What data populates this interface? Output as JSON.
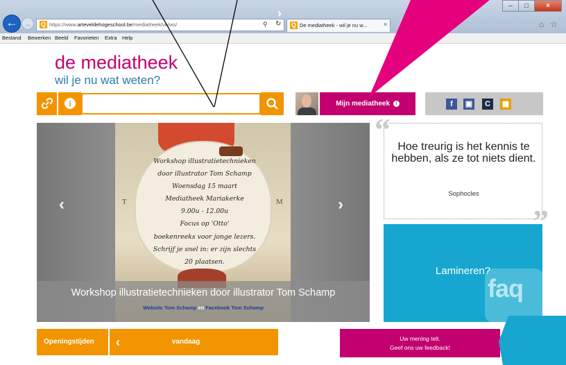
{
  "browser": {
    "address_prefix": "https://www.",
    "address_domain": "arteveldehogeschool.be",
    "address_path": "/mediatheek/ve/ws/",
    "tab_title": "De mediatheek - wil je nu w...",
    "favicon_text": "Q",
    "menu": [
      "Bestand",
      "Bewerken",
      "Beeld",
      "Favorieten",
      "Extra",
      "Help"
    ],
    "icons": [
      "back-arrow-icon",
      "forward-arrow-icon",
      "search-icon",
      "refresh-icon",
      "close-icon",
      "home-icon",
      "star-icon"
    ]
  },
  "header": {
    "title": "de mediatheek",
    "subtitle": "wil je nu wat weten?"
  },
  "search": {
    "value": "",
    "link_icon": "link-icon",
    "info_icon": "info-icon",
    "search_icon": "search-icon"
  },
  "account": {
    "button_label": "Mijn mediatheek"
  },
  "social": [
    "facebook-icon",
    "instagram-icon",
    "c-icon",
    "grid-icon"
  ],
  "carousel": {
    "poster_lines": [
      "Workshop illustratietechnieken",
      "door illustrator Tom Schamp",
      "Woensdag 15 maart",
      "Mediatheek Mariakerke",
      "9.00u - 12.00u",
      "Focus op 'Otto'",
      "boekenreeks voor jonge lezers.",
      "Schrijf je snel in: er zijn slechts",
      "20 plaatsen."
    ],
    "poster_left_letter": "T",
    "poster_right_letter": "M",
    "caption": "Workshop illustratietechnieken door illustrator Tom Schamp",
    "link1": "Website Tom Schamp",
    "link_joiner": "en",
    "link2": "Facebook Tom Schamp"
  },
  "quote": {
    "text": "Hoe treurig is het kennis te hebben, als ze tot niets dient.",
    "author": "Sophocles"
  },
  "laminate": {
    "label": "Lamineren?",
    "badge": "faq"
  },
  "hours": {
    "label": "Openingstijden",
    "day": "vandaag"
  },
  "feedback": {
    "line1": "Uw mening telt.",
    "line2": "Geef ons uw feedback!"
  },
  "colors": {
    "brand_magenta": "#c3006f",
    "brand_orange": "#f29400",
    "brand_blue": "#16a6cf",
    "subtitle_blue": "#2a7aa8"
  }
}
